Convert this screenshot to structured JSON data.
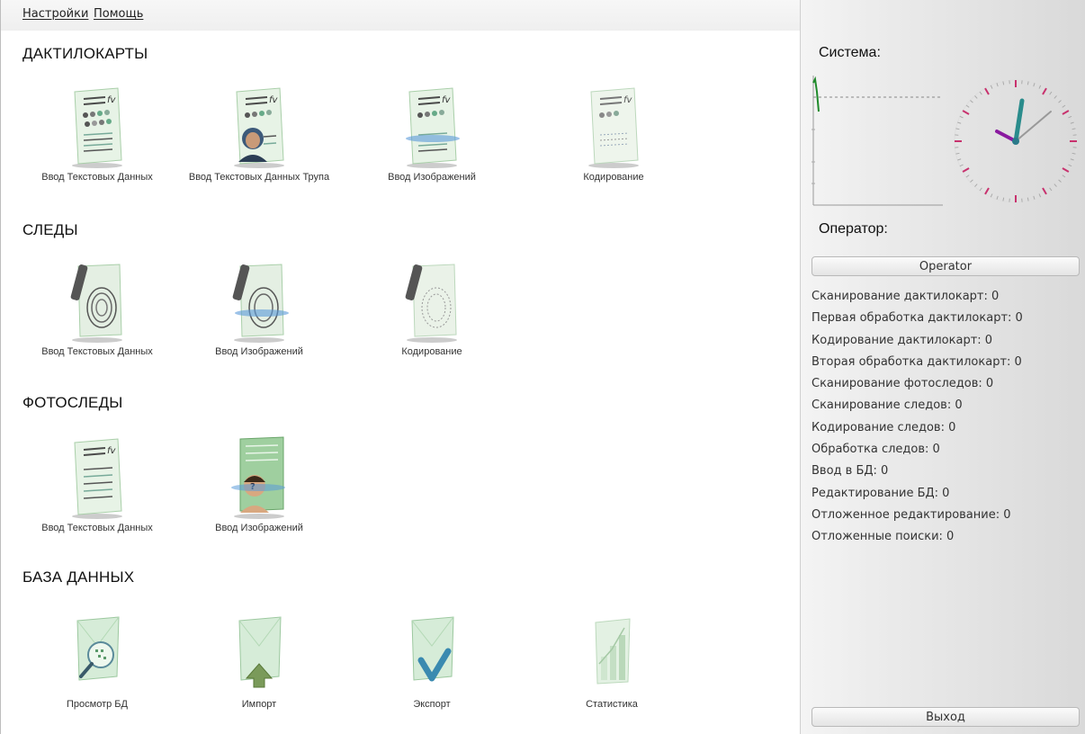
{
  "menubar": {
    "settings": "Настройки",
    "help": "Помощь"
  },
  "sections": {
    "dactylocards": {
      "title": "ДАКТИЛОКАРТЫ",
      "items": [
        {
          "label": "Ввод Текстовых Данных",
          "icon": "fingerprint-card-icon"
        },
        {
          "label": "Ввод Текстовых Данных Трупа",
          "icon": "corpse-card-icon"
        },
        {
          "label": "Ввод Изображений",
          "icon": "scan-card-icon"
        },
        {
          "label": "Кодирование",
          "icon": "encode-card-icon"
        }
      ]
    },
    "traces": {
      "title": "СЛЕДЫ",
      "items": [
        {
          "label": "Ввод Текстовых Данных",
          "icon": "trace-text-icon"
        },
        {
          "label": "Ввод Изображений",
          "icon": "trace-scan-icon"
        },
        {
          "label": "Кодирование",
          "icon": "trace-encode-icon"
        }
      ]
    },
    "phototraces": {
      "title": "ФОТОСЛЕДЫ",
      "items": [
        {
          "label": "Ввод Текстовых Данных",
          "icon": "photo-text-icon"
        },
        {
          "label": "Ввод Изображений",
          "icon": "photo-scan-icon"
        }
      ]
    },
    "database": {
      "title": "БАЗА ДАННЫХ",
      "items": [
        {
          "label": "Просмотр БД",
          "icon": "db-view-icon"
        },
        {
          "label": "Импорт",
          "icon": "db-import-icon"
        },
        {
          "label": "Экспорт",
          "icon": "db-export-icon"
        },
        {
          "label": "Статистика",
          "icon": "db-statistics-icon"
        }
      ]
    }
  },
  "side": {
    "system_label": "Система:",
    "operator_label": "Оператор:",
    "operator_button": "Operator",
    "exit_button": "Выход",
    "stats": [
      "Сканирование дактилокарт: 0",
      "Первая обработка дактилокарт: 0",
      "Кодирование дактилокарт: 0",
      "Вторая обработка дактилокарт: 0",
      "Сканирование фотоследов: 0",
      "Сканирование следов: 0",
      "Кодирование следов: 0",
      "Обработка следов: 0",
      "Ввод в БД: 0",
      "Редактирование БД: 0",
      "Отложенное редактирование: 0",
      "Отложенные поиски: 0"
    ]
  },
  "colors": {
    "icon_green": "#7fbf8a",
    "clock_teal": "#2a8c8c",
    "clock_purple": "#8a1aa0",
    "clock_tick": "#c8326e"
  }
}
